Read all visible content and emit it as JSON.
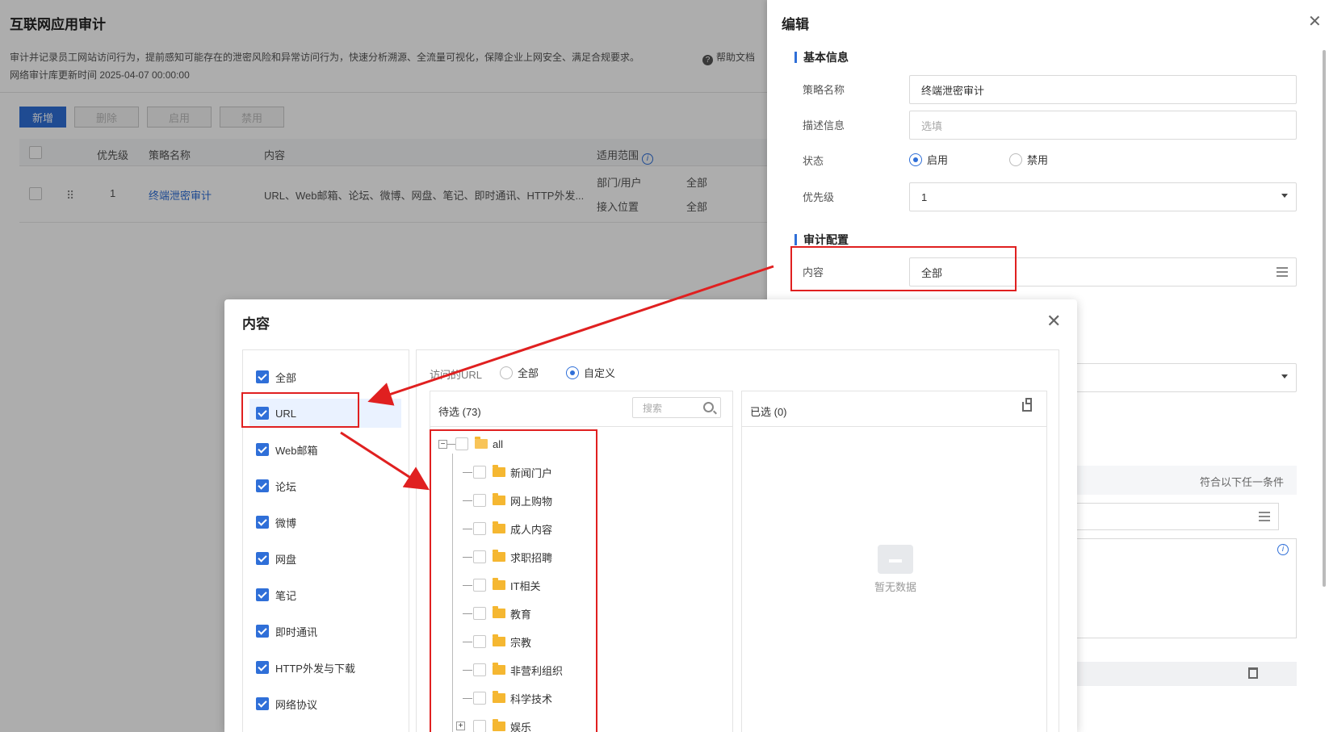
{
  "page": {
    "title": "互联网应用审计",
    "description": "审计并记录员工网站访问行为，提前感知可能存在的泄密风险和异常访问行为，快速分析溯源、全流量可视化，保障企业上网安全、满足合规要求。",
    "help": "帮助文档",
    "update_time": "网络审计库更新时间  2025-04-07 00:00:00",
    "toolbar": {
      "add": "新增",
      "delete": "删除",
      "enable": "启用",
      "disable": "禁用"
    },
    "table": {
      "headers": {
        "priority": "优先级",
        "name": "策略名称",
        "content": "内容",
        "scope": "适用范围"
      },
      "row": {
        "priority": "1",
        "name": "终端泄密审计",
        "content": "URL、Web邮箱、论坛、微博、网盘、笔记、即时通讯、HTTP外发...",
        "scope_dept_label": "部门/用户",
        "scope_dept_value": "全部",
        "scope_loc_label": "接入位置",
        "scope_loc_value": "全部"
      }
    }
  },
  "drawer": {
    "title": "编辑",
    "basic_section": "基本信息",
    "policy_name_label": "策略名称",
    "policy_name_value": "终端泄密审计",
    "desc_label": "描述信息",
    "desc_placeholder": "选填",
    "status_label": "状态",
    "status_enabled": "启用",
    "status_disabled": "禁用",
    "priority_label": "优先级",
    "priority_value": "1",
    "audit_section": "审计配置",
    "content_label": "内容",
    "content_value": "全部",
    "condition_text": "符合以下任一条件"
  },
  "modal": {
    "title": "内容",
    "categories": [
      "全部",
      "URL",
      "Web邮箱",
      "论坛",
      "微博",
      "网盘",
      "笔记",
      "即时通讯",
      "HTTP外发与下载",
      "网络协议"
    ],
    "url_label": "访问的URL",
    "url_all": "全部",
    "url_custom": "自定义",
    "pending_label": "待选 (73)",
    "search_placeholder": "搜索",
    "selected_label": "已选 (0)",
    "empty_text": "暂无数据",
    "tree_root": "all",
    "tree_children": [
      "新闻门户",
      "网上购物",
      "成人内容",
      "求职招聘",
      "IT相关",
      "教育",
      "宗教",
      "非营利组织",
      "科学技术",
      "娱乐"
    ]
  },
  "colors": {
    "accent": "#2f6fd8",
    "annotation": "#e02020",
    "folder": "#f5b731"
  }
}
